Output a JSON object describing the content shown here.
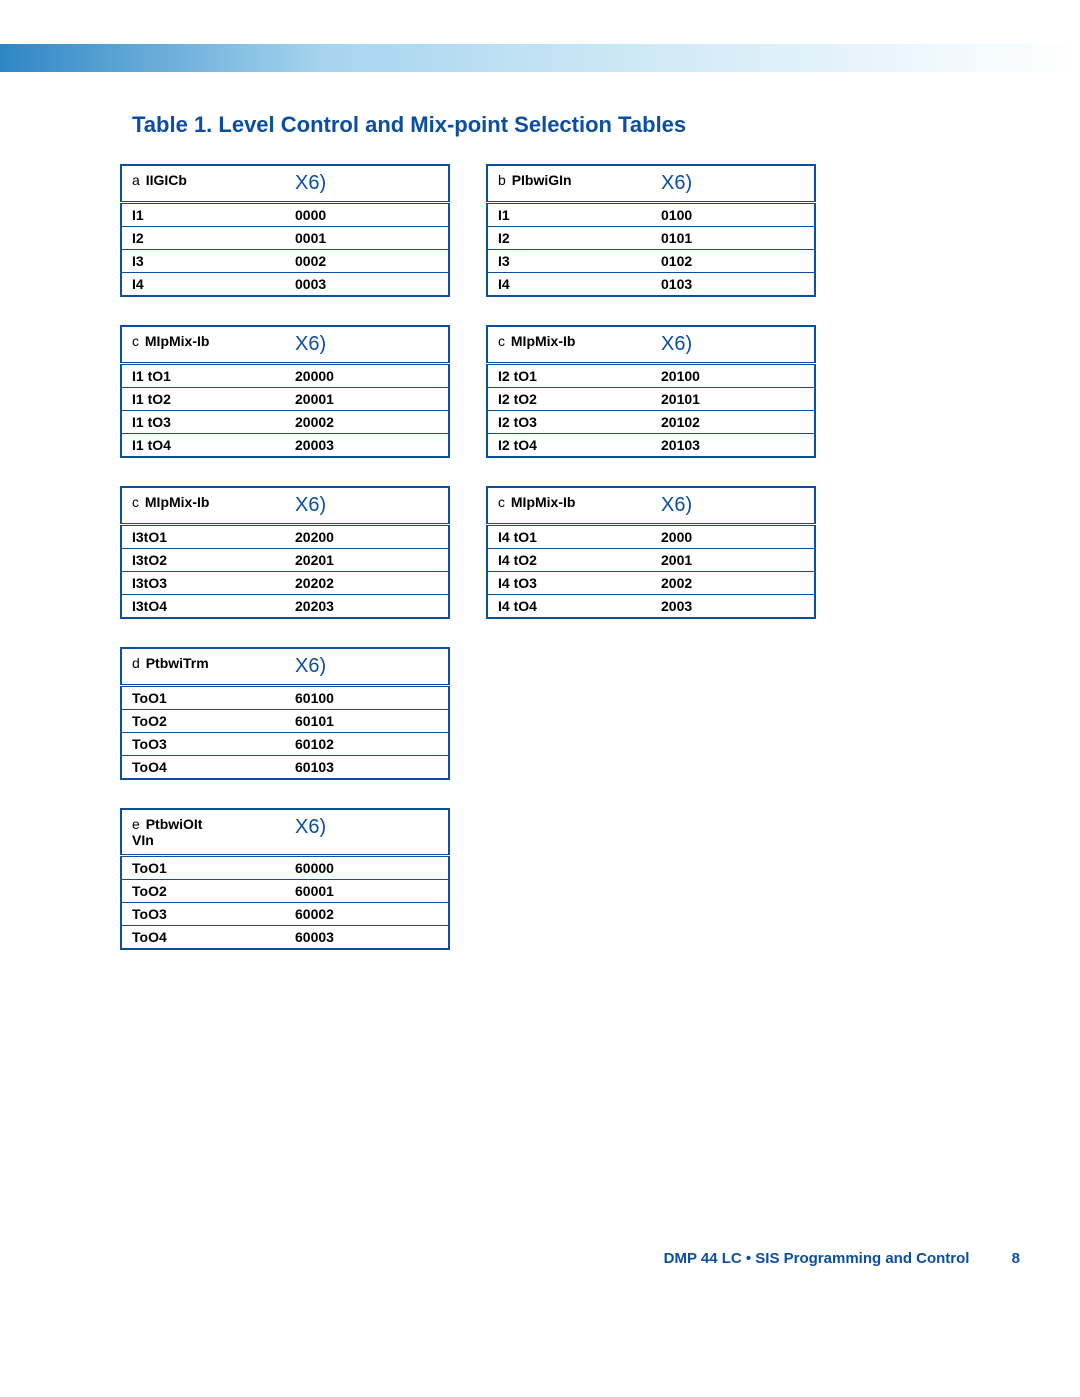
{
  "title": "Table 1.   Level Control and Mix-point Selection Tables",
  "x6": "X6)",
  "tables": [
    {
      "pre": "a",
      "header": "IIGICb",
      "rows": [
        {
          "l": "I1",
          "v": "0000"
        },
        {
          "l": "I2",
          "v": "0001"
        },
        {
          "l": "I3",
          "v": "0002"
        },
        {
          "l": "I4",
          "v": "0003"
        }
      ]
    },
    {
      "pre": "b",
      "header": "PIbwiGIn",
      "rows": [
        {
          "l": "I1",
          "v": "0100"
        },
        {
          "l": "I2",
          "v": "0101"
        },
        {
          "l": "I3",
          "v": "0102"
        },
        {
          "l": "I4",
          "v": "0103"
        }
      ]
    },
    {
      "pre": "c",
      "header": "MIpMix-Ib",
      "rows": [
        {
          "l": "I1 tO1",
          "v": "20000"
        },
        {
          "l": "I1 tO2",
          "v": "20001"
        },
        {
          "l": "I1 tO3",
          "v": "20002"
        },
        {
          "l": "I1 tO4",
          "v": "20003"
        }
      ]
    },
    {
      "pre": "c",
      "header": "MIpMix-Ib",
      "rows": [
        {
          "l": "I2 tO1",
          "v": "20100"
        },
        {
          "l": "I2 tO2",
          "v": "20101"
        },
        {
          "l": "I2 tO3",
          "v": "20102"
        },
        {
          "l": "I2 tO4",
          "v": "20103"
        }
      ]
    },
    {
      "pre": "c",
      "header": "MIpMix-Ib",
      "rows": [
        {
          "l": "I3tO1",
          "v": "20200"
        },
        {
          "l": "I3tO2",
          "v": "20201"
        },
        {
          "l": "I3tO3",
          "v": "20202"
        },
        {
          "l": "I3tO4",
          "v": "20203"
        }
      ]
    },
    {
      "pre": "c",
      "header": "MIpMix-Ib",
      "rows": [
        {
          "l": "I4 tO1",
          "v": "2000"
        },
        {
          "l": "I4 tO2",
          "v": "2001"
        },
        {
          "l": "I4 tO3",
          "v": "2002"
        },
        {
          "l": "I4 tO4",
          "v": "2003"
        }
      ]
    },
    {
      "pre": "d",
      "header": "PtbwiTrm",
      "rows": [
        {
          "l": "ToO1",
          "v": "60100"
        },
        {
          "l": "ToO2",
          "v": "60101"
        },
        {
          "l": "ToO3",
          "v": "60102"
        },
        {
          "l": "ToO4",
          "v": "60103"
        }
      ]
    },
    {
      "pre": "e",
      "header": "PtbwiOIt\nVIn",
      "rows": [
        {
          "l": "ToO1",
          "v": "60000"
        },
        {
          "l": "ToO2",
          "v": "60001"
        },
        {
          "l": "ToO3",
          "v": "60002"
        },
        {
          "l": "ToO4",
          "v": "60003"
        }
      ]
    }
  ],
  "footer": {
    "text": "DMP 44 LC • SIS Programming and Control",
    "page": "8"
  }
}
